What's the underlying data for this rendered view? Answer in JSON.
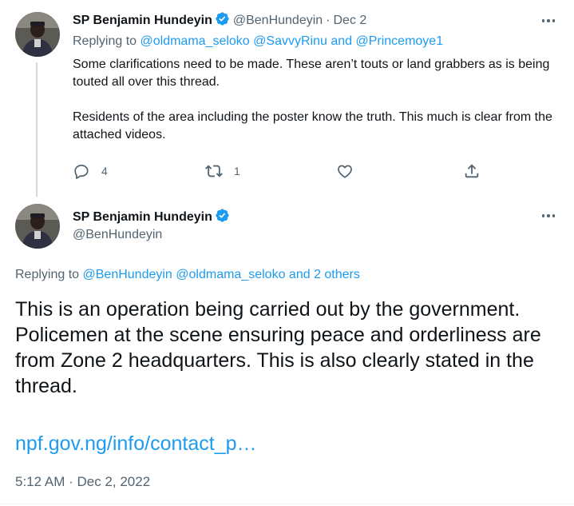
{
  "tweet_reply": {
    "author_name": "SP Benjamin Hundeyin",
    "handle": "@BenHundeyin",
    "separator": "·",
    "date": "Dec 2",
    "replying_label": "Replying to",
    "replying_to": [
      "@oldmama_seloko",
      "@SavvyRinu",
      "and",
      "@Princemoye1"
    ],
    "paragraphs": [
      "Some clarifications need to be made. These aren’t touts or land grabbers as is being touted all over this thread.",
      "Residents of the area including the poster know the truth. This much is clear from the attached videos."
    ],
    "actions": {
      "reply_count": "4",
      "retweet_count": "1"
    }
  },
  "main_tweet": {
    "author_name": "SP Benjamin Hundeyin",
    "handle": "@BenHundeyin",
    "replying_label": "Replying to",
    "replying_to": [
      "@BenHundeyin",
      "@oldmama_seloko",
      "and 2 others"
    ],
    "text": "This is an operation being carried out by the government. Policemen at the scene ensuring peace and orderliness are from Zone 2 headquarters. This is also clearly stated in the thread.",
    "link": "npf.gov.ng/info/contact_p…",
    "timestamp": "5:12 AM · Dec 2, 2022"
  },
  "colors": {
    "accent": "#1d9bf0",
    "secondary_text": "#536471",
    "primary_text": "#0f1419",
    "thread_line": "#cfd9de"
  },
  "icons": [
    "verified-badge-icon",
    "more-icon",
    "reply-icon",
    "retweet-icon",
    "like-icon",
    "share-icon"
  ]
}
